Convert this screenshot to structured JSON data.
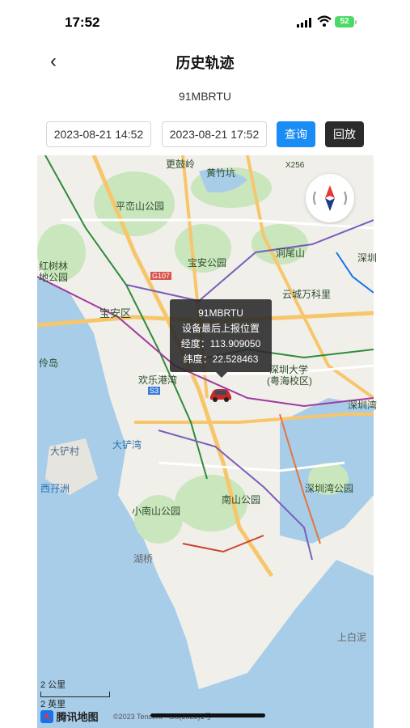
{
  "status": {
    "time": "17:52",
    "battery": "52"
  },
  "header": {
    "title": "历史轨迹"
  },
  "vehicle": {
    "plate": "91MBRTU"
  },
  "query": {
    "start": "2023-08-21 14:52",
    "end": "2023-08-21 17:52",
    "search_label": "查询",
    "replay_label": "回放"
  },
  "tooltip": {
    "plate": "91MBRTU",
    "desc": "设备最后上报位置",
    "lng_label": "经度：",
    "lng": "113.909050",
    "lat_label": "纬度：",
    "lat": "22.528463"
  },
  "map": {
    "labels": {
      "gbs": "更鼓岭",
      "hxk": "黄竹坑",
      "x256": "X256",
      "pds": "平峦山公园",
      "hsl": "红树林",
      "hsl2": "地公园",
      "ba": "宝安公园",
      "g107": "G107",
      "dws": "洞尾山",
      "sz": "深圳",
      "ycw": "云城万科里",
      "bar": "宝安区",
      "lz": "伶岛",
      "hlg": "欢乐港湾",
      "s3": "S3",
      "szu": "深圳大学",
      "szu2": "(粤海校区)",
      "szw": "深圳湾",
      "dcun": "大铲村",
      "dcw": "大铲湾",
      "xzz": "西孖洲",
      "ns": "南山公园",
      "szwp": "深圳湾公园",
      "xns": "小南山公园",
      "hq": "湖桥",
      "sbn": "上白泥"
    },
    "scale": {
      "km": "2 公里",
      "mi": "2 英里"
    },
    "logo": "腾讯地图",
    "copyright": "©2023 Tencent - GS(2023)1号"
  },
  "colors": {
    "search": "#1a8cf5",
    "replay": "#2b2b2b",
    "sea": "#a8cde9",
    "park": "#c9e6bd",
    "road": "#f7c66b"
  }
}
